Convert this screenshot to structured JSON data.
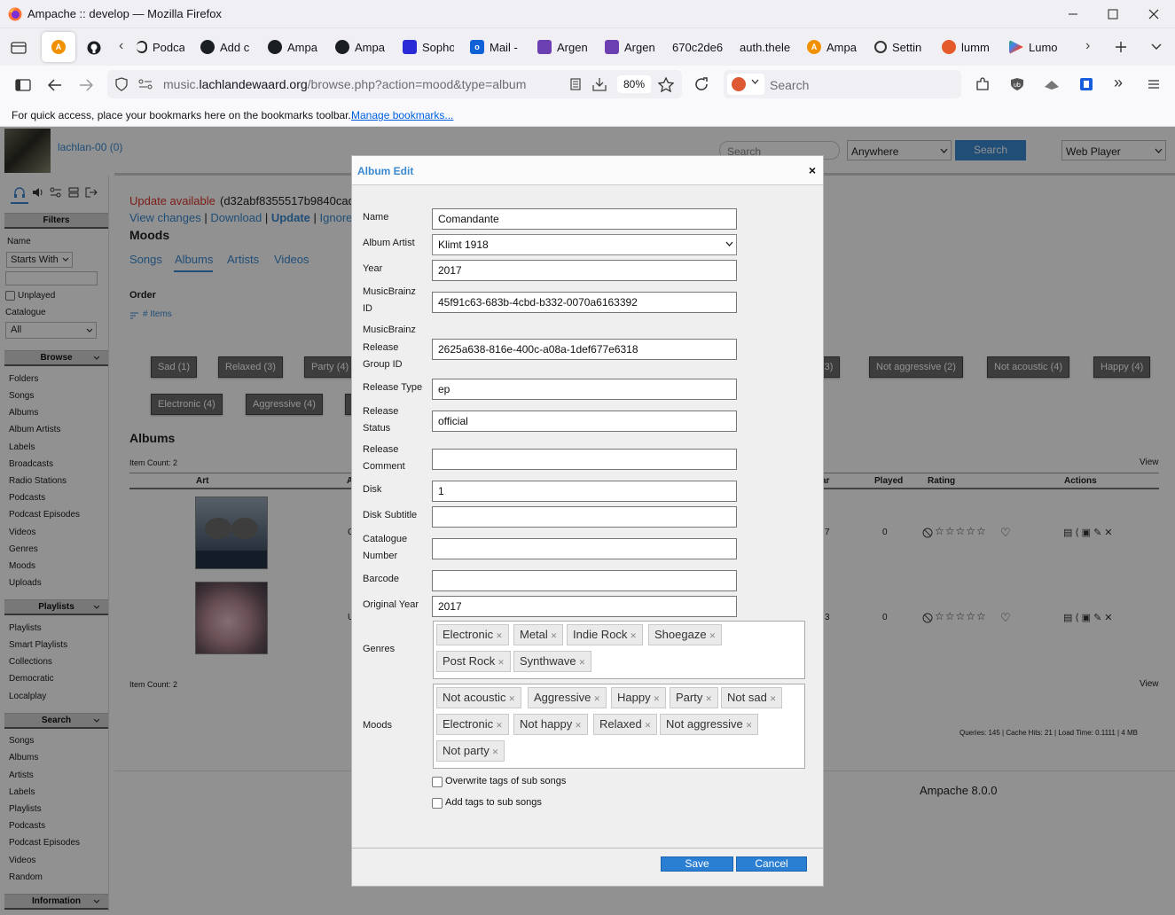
{
  "window": {
    "title": "Ampache :: develop — Mozilla Firefox"
  },
  "browser": {
    "tabs": [
      "Podca",
      "Add c",
      "Ampa",
      "Ampa",
      "Sopho",
      "Mail -",
      "Argen",
      "Argen",
      "670c2de6",
      "auth.thele",
      "Ampa",
      "Settin",
      "lumm",
      "Lumo"
    ],
    "url_prefix": "music.",
    "url_domain": "lachlandewaard.org",
    "url_path": "/browse.php?action=mood&type=album",
    "zoom": "80%",
    "search_placeholder": "Search",
    "bookmarks_text": "For quick access, place your bookmarks here on the bookmarks toolbar.",
    "bookmarks_link": "Manage bookmarks..."
  },
  "header": {
    "user": "lachlan-00 (0)",
    "search_placeholder": "Search",
    "scope": "Anywhere",
    "search_button": "Search",
    "player": "Web Player"
  },
  "sidebar": {
    "filters_title": "Filters",
    "name_label": "Name",
    "starts_with": "Starts With",
    "unplayed": "Unplayed",
    "catalogue_label": "Catalogue",
    "catalogue_value": "All",
    "browse_title": "Browse",
    "browse_items": [
      "Folders",
      "Songs",
      "Albums",
      "Album Artists",
      "Labels",
      "Broadcasts",
      "Radio Stations",
      "Podcasts",
      "Podcast Episodes",
      "Videos",
      "Genres",
      "Moods",
      "Uploads"
    ],
    "playlists_title": "Playlists",
    "playlists_items": [
      "Playlists",
      "Smart Playlists",
      "Collections",
      "Democratic",
      "Localplay"
    ],
    "search_title": "Search",
    "search_items": [
      "Songs",
      "Albums",
      "Artists",
      "Labels",
      "Playlists",
      "Podcasts",
      "Podcast Episodes",
      "Videos",
      "Random"
    ],
    "information_title": "Information"
  },
  "main": {
    "update_text": "Update available",
    "update_hash": "(d32abf8355517b9840cad",
    "links": {
      "view_changes": "View changes",
      "download": "Download",
      "update": "Update",
      "ignore": "Ignore"
    },
    "sep": "|",
    "moods_title": "Moods",
    "tabs": [
      "Songs",
      "Albums",
      "Artists",
      "Videos"
    ],
    "order_label": "Order",
    "items_label": "# Items",
    "mood_buttons": [
      "Sad (1)",
      "Relaxed (3)",
      "Party (4)",
      "(3)",
      "Not aggressive (2)",
      "Not acoustic (4)",
      "Happy (4)",
      "Electronic (4)",
      "Aggressive (4)"
    ],
    "albums_title": "Albums",
    "item_count": "Item Count: 2",
    "view_label": "View",
    "columns": {
      "art": "Art",
      "a": "A",
      "year": "ar",
      "played": "Played",
      "rating": "Rating",
      "actions": "Actions"
    },
    "rows": [
      {
        "col_a": "C",
        "year": "7",
        "played": "0"
      },
      {
        "col_a": "U",
        "year": "3",
        "played": "0"
      }
    ],
    "stats": "Queries: 145 | Cache Hits: 21 | Load Time: 0.1111 | 4 MB",
    "version": "Ampache 8.0.0"
  },
  "modal": {
    "title": "Album Edit",
    "close": "×",
    "fields": {
      "name": {
        "label": "Name",
        "value": "Comandante"
      },
      "album_artist": {
        "label": "Album Artist",
        "value": "Klimt 1918"
      },
      "year": {
        "label": "Year",
        "value": "2017"
      },
      "mbid": {
        "label1": "MusicBrainz",
        "label2": "ID",
        "value": "45f91c63-683b-4cbd-b332-0070a6163392"
      },
      "release_group": {
        "label1": "MusicBrainz",
        "label2": "Release",
        "label3": "Group ID",
        "value": "2625a638-816e-400c-a08a-1def677e6318"
      },
      "release_type": {
        "label": "Release Type",
        "value": "ep"
      },
      "release_status": {
        "label1": "Release",
        "label2": "Status",
        "value": "official"
      },
      "release_comment": {
        "label1": "Release",
        "label2": "Comment",
        "value": ""
      },
      "disk": {
        "label": "Disk",
        "value": "1"
      },
      "disk_subtitle": {
        "label": "Disk Subtitle",
        "value": ""
      },
      "catalogue_number": {
        "label1": "Catalogue",
        "label2": "Number",
        "value": ""
      },
      "barcode": {
        "label": "Barcode",
        "value": ""
      },
      "original_year": {
        "label": "Original Year",
        "value": "2017"
      }
    },
    "genres_label": "Genres",
    "genres": [
      "Electronic",
      "Metal",
      "Indie Rock",
      "Shoegaze",
      "Post Rock",
      "Synthwave"
    ],
    "moods_label": "Moods",
    "moods": [
      "Not acoustic",
      "Aggressive",
      "Happy",
      "Party",
      "Not sad",
      "Electronic",
      "Not happy",
      "Relaxed",
      "Not aggressive",
      "Not party"
    ],
    "overwrite_label": "Overwrite tags of sub songs",
    "add_tags_label": "Add tags to sub songs",
    "save": "Save",
    "cancel": "Cancel"
  },
  "colors": {
    "accent": "#3a8ad1",
    "update_red": "#d9342b",
    "button_blue": "#2b7fd3"
  }
}
